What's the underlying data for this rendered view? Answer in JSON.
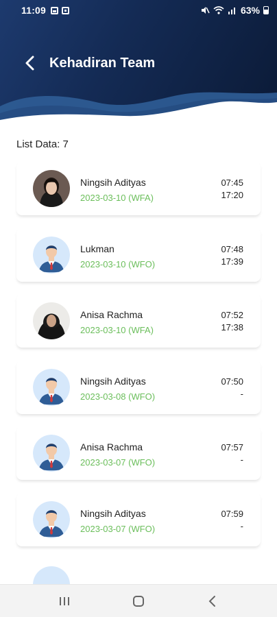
{
  "status_bar": {
    "time": "11:09",
    "battery": "63%",
    "icons": [
      "gallery-icon",
      "mail-icon",
      "mute-icon",
      "wifi-icon",
      "signal-icon",
      "battery-icon"
    ]
  },
  "header": {
    "title": "Kehadiran Team",
    "back_icon": "chevron-left-icon"
  },
  "list_count_label": "List Data: 7",
  "records": [
    {
      "name": "Ningsih Adityas",
      "date": "2023-03-10 (WFA)",
      "in": "07:45",
      "out": "17:20",
      "avatar": "photo"
    },
    {
      "name": "Lukman",
      "date": "2023-03-10 (WFO)",
      "in": "07:48",
      "out": "17:39",
      "avatar": "default"
    },
    {
      "name": "Anisa Rachma",
      "date": "2023-03-10 (WFA)",
      "in": "07:52",
      "out": "17:38",
      "avatar": "photo-hijab"
    },
    {
      "name": "Ningsih Adityas",
      "date": "2023-03-08 (WFO)",
      "in": "07:50",
      "out": "-",
      "avatar": "default"
    },
    {
      "name": "Anisa Rachma",
      "date": "2023-03-07 (WFO)",
      "in": "07:57",
      "out": "-",
      "avatar": "default"
    },
    {
      "name": "Ningsih Adityas",
      "date": "2023-03-07 (WFO)",
      "in": "07:59",
      "out": "-",
      "avatar": "default"
    }
  ],
  "colors": {
    "header_dark": "#0b1a36",
    "header_mid": "#1d3a6e",
    "wave": "#2f5d96",
    "date_green": "#6abe5a",
    "avatar_bg": "#d6e8fb"
  },
  "nav": {
    "recents_icon": "recents-icon",
    "home_icon": "home-icon",
    "back_icon": "back-icon"
  }
}
